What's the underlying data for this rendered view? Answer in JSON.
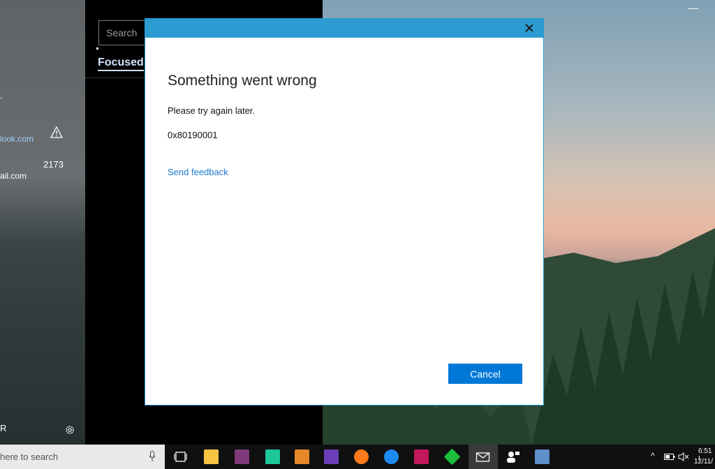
{
  "mail_app": {
    "left_pane": {
      "account1": "look.com",
      "account2": "ail.com",
      "count": "2173",
      "bottom_letter": "R"
    },
    "search_placeholder": "Search",
    "focused_tab": "Focused"
  },
  "dialog": {
    "title": "Something went wrong",
    "message": "Please try again later.",
    "error_code": "0x80190001",
    "feedback_link": "Send feedback",
    "cancel_label": "Cancel"
  },
  "taskbar": {
    "search_text": "here to search",
    "time": "6:51 I",
    "date": "12/11/",
    "apps": [
      "task-view",
      "file-explorer",
      "onenote",
      "datagrip",
      "sublime-text",
      "visual-studio",
      "firefox",
      "firefox-dev",
      "rider",
      "git-app",
      "mail",
      "people",
      "remote-desktop"
    ]
  },
  "colors": {
    "accent": "#0078d7",
    "titlebar": "#2b9bd2",
    "link": "#1f78d1"
  }
}
